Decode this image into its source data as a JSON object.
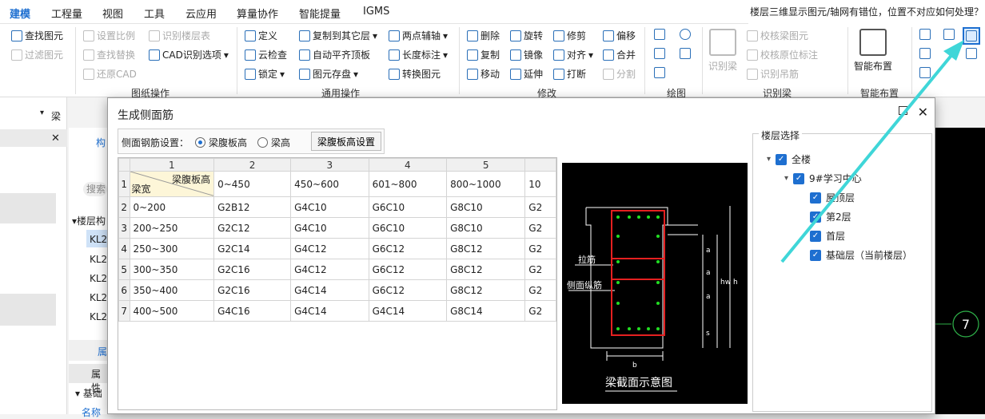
{
  "menu": {
    "items": [
      "建模",
      "工程量",
      "视图",
      "工具",
      "云应用",
      "算量协作",
      "智能提量",
      "IGMS"
    ],
    "notice": "楼层三维显示图元/轴网有错位，位置不对应如何处理？"
  },
  "ribbon": {
    "g1": [
      "查找图元",
      "过滤图元"
    ],
    "g2": [
      "设置比例",
      "识别楼层表",
      "查找替换",
      "CAD识别选项",
      "还原CAD"
    ],
    "g2_label": "图纸操作",
    "g3": [
      "定义",
      "复制到其它层",
      "两点辅轴",
      "云检查",
      "自动平齐顶板",
      "长度标注",
      "锁定",
      "图元存盘",
      "转换图元"
    ],
    "g3_label": "通用操作",
    "g4": [
      "删除",
      "旋转",
      "修剪",
      "偏移",
      "复制",
      "镜像",
      "对齐",
      "合并",
      "移动",
      "延伸",
      "打断",
      "分割"
    ],
    "g4_label": "修改",
    "g5_label": "绘图",
    "g6": [
      "识别梁",
      "校核梁图元",
      "校核原位标注",
      "识别吊筋"
    ],
    "g6_label": "识别梁",
    "g7": "智能布置",
    "g7_label": "智能布置"
  },
  "left": {
    "dropdown": "梁",
    "search": "搜索",
    "tree_head": "楼层构",
    "items": [
      "KL2",
      "KL2",
      "KL2",
      "KL2",
      "KL2"
    ],
    "prop_tab": "属",
    "prop_head": "属性",
    "prop_group": "基础",
    "prop_name": "名称"
  },
  "canvas": {
    "axis": "7"
  },
  "dialog": {
    "title": "生成侧面筋",
    "opt_label": "侧面钢筋设置：",
    "radio1": "梁腹板高",
    "radio2": "梁高",
    "set_btn": "梁腹板高设置",
    "col_nums": [
      "1",
      "2",
      "3",
      "4",
      "5"
    ],
    "corner_top": "梁腹板高",
    "corner_bottom": "梁宽",
    "col_heads": [
      "0~450",
      "450~600",
      "601~800",
      "800~1000",
      "10"
    ],
    "rows": [
      {
        "n": "2",
        "w": "0~200",
        "c": [
          "G2B12",
          "G4C10",
          "G6C10",
          "G8C10",
          "G2"
        ]
      },
      {
        "n": "3",
        "w": "200~250",
        "c": [
          "G2C12",
          "G4C10",
          "G6C10",
          "G8C10",
          "G2"
        ]
      },
      {
        "n": "4",
        "w": "250~300",
        "c": [
          "G2C14",
          "G4C12",
          "G6C12",
          "G8C12",
          "G2"
        ]
      },
      {
        "n": "5",
        "w": "300~350",
        "c": [
          "G2C16",
          "G4C12",
          "G6C12",
          "G8C12",
          "G2"
        ]
      },
      {
        "n": "6",
        "w": "350~400",
        "c": [
          "G2C16",
          "G4C14",
          "G6C12",
          "G8C12",
          "G2"
        ]
      },
      {
        "n": "7",
        "w": "400~500",
        "c": [
          "G4C16",
          "G4C14",
          "G4C14",
          "G8C14",
          "G2"
        ]
      }
    ],
    "diagram": {
      "caption": "梁截面示意图",
      "l1": "拉筋",
      "l2": "侧面纵筋",
      "a": "a",
      "hw": "hw",
      "h": "h",
      "s": "s",
      "b": "b"
    },
    "floor_title": "楼层选择",
    "floors": {
      "all": "全楼",
      "project": "9#学习中心",
      "f1": "屋顶层",
      "f2": "第2层",
      "f3": "首层",
      "f4": "基础层（当前楼层）"
    }
  },
  "colors": {
    "accent": "#1e6fd0",
    "arrow": "#3fd6d8",
    "rebar": "#e52020",
    "dot": "#22dd22"
  }
}
